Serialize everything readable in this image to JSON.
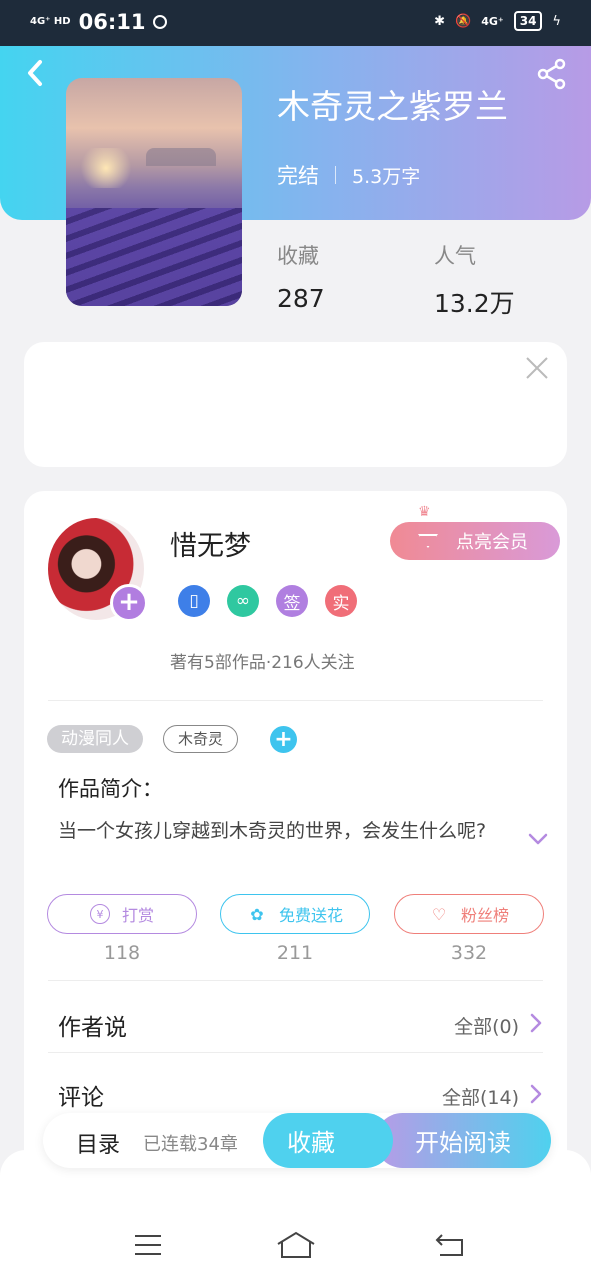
{
  "status_bar": {
    "network": "4G⁺ HD",
    "time": "06:11",
    "network_right": "4G⁺",
    "battery": "34"
  },
  "header": {
    "back_icon": "chevron-left-icon",
    "share_icon": "share-icon"
  },
  "book": {
    "title": "木奇灵之紫罗兰",
    "status": "完结",
    "words": "5.3万字",
    "stats": [
      {
        "label": "收藏",
        "value": "287"
      },
      {
        "label": "人气",
        "value": "13.2万"
      }
    ]
  },
  "ad": {
    "close_icon": "close-icon"
  },
  "author": {
    "name": "惜无梦",
    "vip_label": "点亮会员",
    "badges": [
      {
        "text": "",
        "icon": "phone-badge-icon",
        "color": "#3e7fe8"
      },
      {
        "text": "",
        "icon": "handshake-badge-icon",
        "color": "#2fc8a0"
      },
      {
        "text": "签",
        "icon": "signed-badge-icon",
        "color": "#b07fe0"
      },
      {
        "text": "实",
        "icon": "verified-badge-icon",
        "color": "#f06e78"
      }
    ],
    "works_info": "著有5部作品·216人关注"
  },
  "tags": {
    "primary": "动漫同人",
    "secondary": "木奇灵"
  },
  "intro": {
    "title": "作品简介：",
    "text": "当一个女孩儿穿越到木奇灵的世界，会发生什么呢?"
  },
  "actions": [
    {
      "label": "打赏",
      "count": "118",
      "icon": "yuan-icon",
      "color": "#b48ae0"
    },
    {
      "label": "免费送花",
      "count": "211",
      "icon": "flower-icon",
      "color": "#3ec4ee"
    },
    {
      "label": "粉丝榜",
      "count": "332",
      "icon": "fans-icon",
      "color": "#ef7f7a"
    }
  ],
  "author_says": {
    "title": "作者说",
    "link": "全部(0)"
  },
  "comments": {
    "title": "评论",
    "link": "全部(14)"
  },
  "bottom_bar": {
    "catalog": "目录",
    "chapters": "已连载34章",
    "favorite": "收藏",
    "read": "开始阅读"
  },
  "nav": {
    "menu_icon": "menu-icon",
    "home_icon": "home-icon",
    "back_icon": "back-icon"
  },
  "colors": {
    "accent_cyan": "#4fd1ee",
    "accent_purple": "#b79be6"
  }
}
